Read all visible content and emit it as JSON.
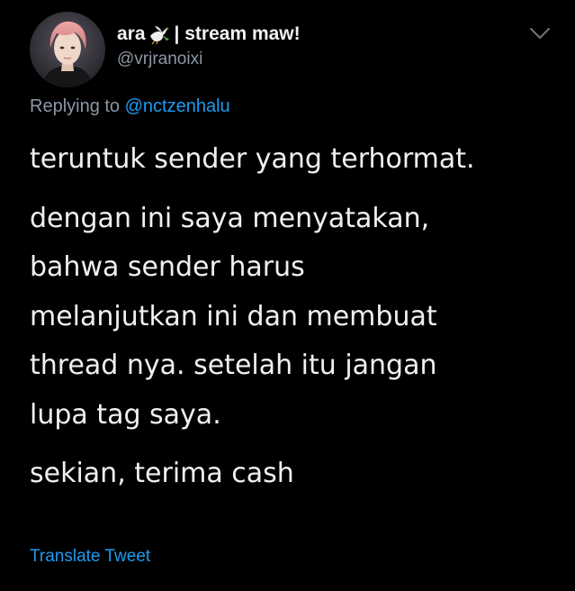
{
  "tweet": {
    "display_name": "ara",
    "name_suffix": " | stream maw!",
    "handle": "@vrjranoixi",
    "replying_prefix": "Replying to ",
    "replying_to": "@nctzenhalu",
    "paragraphs": [
      [
        "teruntuk sender yang terhormat."
      ],
      [
        "dengan ini saya menyatakan,",
        "bahwa sender harus",
        "melanjutkan ini dan membuat",
        "thread nya. setelah itu jangan",
        "lupa tag saya."
      ],
      [
        "sekian, terima cash"
      ]
    ],
    "translate_label": "Translate Tweet"
  },
  "icons": {
    "avatar": "profile-photo",
    "name_emoji": "dove-icon",
    "menu": "chevron-down-icon"
  },
  "colors": {
    "background": "#000000",
    "primary_text": "#e7e9ea",
    "secondary_text": "#8b98a5",
    "link": "#1d9bf0"
  }
}
